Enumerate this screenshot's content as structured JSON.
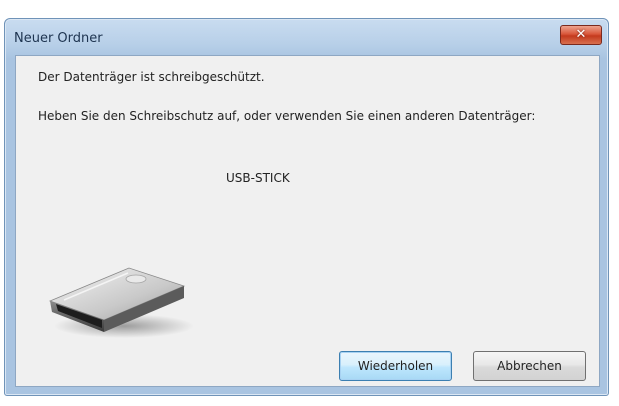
{
  "window": {
    "title": "Neuer Ordner",
    "close_symbol": "✕"
  },
  "dialog": {
    "message_primary": "Der Datenträger ist schreibgeschützt.",
    "message_secondary": "Heben Sie den Schreibschutz auf, oder verwenden Sie einen anderen Datenträger:",
    "device_name": "USB-STICK",
    "icon": "removable-drive-icon"
  },
  "buttons": {
    "retry_label": "Wiederholen",
    "cancel_label": "Abbrechen"
  },
  "colors": {
    "title_gradient_top": "#c9dcf0",
    "close_red": "#c43a1d",
    "content_bg": "#f0f0f0",
    "default_button_border": "#3c7fb1"
  }
}
